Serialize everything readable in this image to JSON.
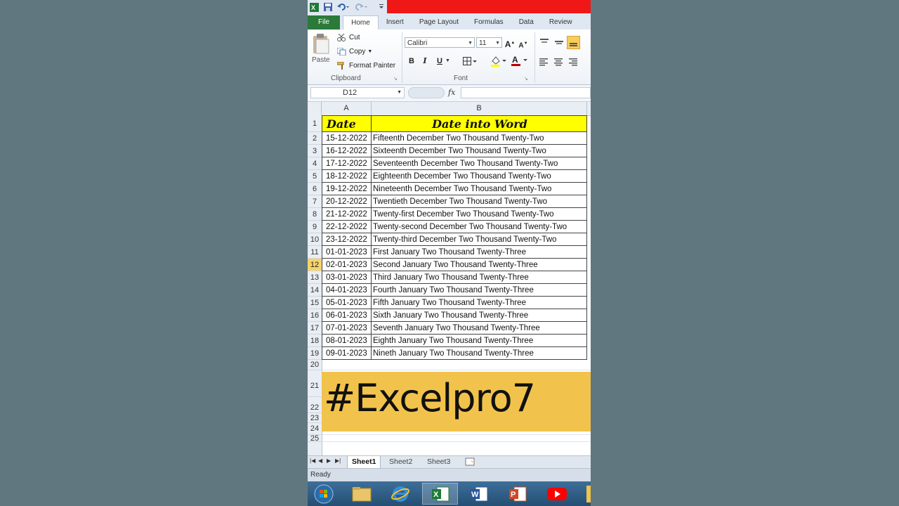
{
  "ribbon": {
    "tabs": [
      "File",
      "Home",
      "Insert",
      "Page Layout",
      "Formulas",
      "Data",
      "Review"
    ],
    "active_tab": "Home",
    "clipboard": {
      "paste_label": "Paste",
      "cut_label": "Cut",
      "copy_label": "Copy",
      "format_painter_label": "Format Painter",
      "group_label": "Clipboard"
    },
    "font": {
      "name": "Calibri",
      "size": "11",
      "group_label": "Font",
      "bold": "B",
      "italic": "I",
      "underline": "U"
    }
  },
  "formula_bar": {
    "name_box": "D12",
    "fx_label": "fx",
    "content": ""
  },
  "grid": {
    "column_headers": [
      "A",
      "B"
    ],
    "row_numbers": [
      "1",
      "2",
      "3",
      "4",
      "5",
      "6",
      "7",
      "8",
      "9",
      "10",
      "11",
      "12",
      "13",
      "14",
      "15",
      "16",
      "17",
      "18",
      "19",
      "20",
      "21",
      "22",
      "23",
      "24",
      "25"
    ],
    "selected_row": "12",
    "header": {
      "date": "Date",
      "word": "Date into Word"
    },
    "rows": [
      {
        "date": "15-12-2022",
        "word": "Fifteenth December Two Thousand Twenty-Two"
      },
      {
        "date": "16-12-2022",
        "word": "Sixteenth December Two Thousand Twenty-Two"
      },
      {
        "date": "17-12-2022",
        "word": "Seventeenth December Two Thousand Twenty-Two"
      },
      {
        "date": "18-12-2022",
        "word": "Eighteenth December Two Thousand Twenty-Two"
      },
      {
        "date": "19-12-2022",
        "word": "Nineteenth December Two Thousand Twenty-Two"
      },
      {
        "date": "20-12-2022",
        "word": "Twentieth December Two Thousand Twenty-Two"
      },
      {
        "date": "21-12-2022",
        "word": "Twenty-first December Two Thousand Twenty-Two"
      },
      {
        "date": "22-12-2022",
        "word": "Twenty-second December Two Thousand Twenty-Two"
      },
      {
        "date": "23-12-2022",
        "word": "Twenty-third December Two Thousand Twenty-Two"
      },
      {
        "date": "01-01-2023",
        "word": "First January Two Thousand Twenty-Three"
      },
      {
        "date": "02-01-2023",
        "word": "Second January Two Thousand Twenty-Three"
      },
      {
        "date": "03-01-2023",
        "word": "Third January Two Thousand Twenty-Three"
      },
      {
        "date": "04-01-2023",
        "word": "Fourth January Two Thousand Twenty-Three"
      },
      {
        "date": "05-01-2023",
        "word": "Fifth January Two Thousand Twenty-Three"
      },
      {
        "date": "06-01-2023",
        "word": "Sixth January Two Thousand Twenty-Three"
      },
      {
        "date": "07-01-2023",
        "word": "Seventh January Two Thousand Twenty-Three"
      },
      {
        "date": "08-01-2023",
        "word": "Eighth January Two Thousand Twenty-Three"
      },
      {
        "date": "09-01-2023",
        "word": "Nineth January Two Thousand Twenty-Three"
      }
    ]
  },
  "sheets": [
    "Sheet1",
    "Sheet2",
    "Sheet3"
  ],
  "active_sheet": "Sheet1",
  "status": "Ready",
  "overlay_text": "#Excelpro7",
  "colors": {
    "header_fill": "#ffff00",
    "overlay_fill": "#f2c34c",
    "file_tab": "#2c7a3a",
    "title_red": "#f01717",
    "selected_row": "#f6d36b"
  },
  "taskbar": [
    "windows-start-icon",
    "file-explorer-icon",
    "internet-explorer-icon",
    "excel-icon",
    "word-icon",
    "powerpoint-icon",
    "youtube-icon"
  ]
}
